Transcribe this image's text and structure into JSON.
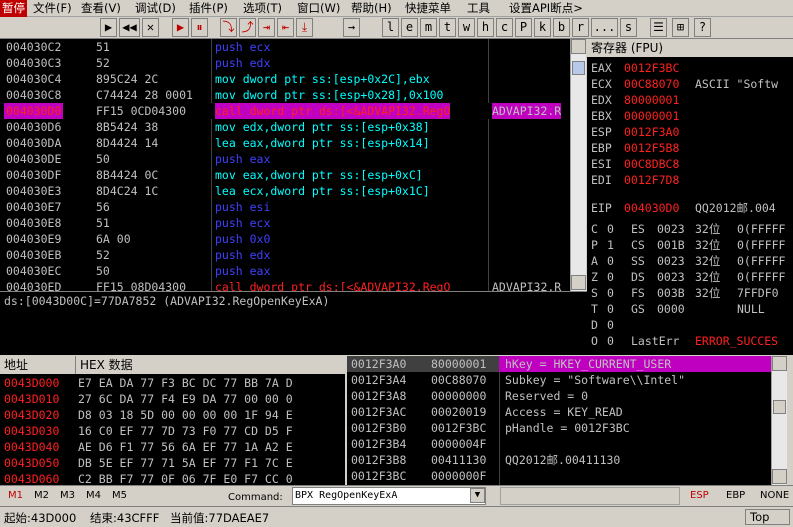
{
  "menubar": {
    "status": "暂停",
    "items": [
      "文件(F)",
      "查看(V)",
      "调试(D)",
      "插件(P)",
      "选项(T)",
      "窗口(W)",
      "帮助(H)",
      "快捷菜单",
      "工具",
      "设置API断点>"
    ]
  },
  "toolbar": {
    "buttons": [
      "▶",
      "◀◀",
      "✕",
      "▶",
      "⏸",
      "⤵",
      "⤴",
      "⇥",
      "⇤",
      "⤓",
      "→",
      "l",
      "e",
      "m",
      "t",
      "w",
      "h",
      "c",
      "P",
      "k",
      "b",
      "r",
      "...",
      "s",
      "☰",
      "⊞",
      "?"
    ]
  },
  "disasm": [
    {
      "addr": "004030C2",
      "hex": "51",
      "asm": "push ecx",
      "acls": "blue"
    },
    {
      "addr": "004030C3",
      "hex": "52",
      "asm": "push edx",
      "acls": "blue"
    },
    {
      "addr": "004030C4",
      "hex": "895C24 2C",
      "asm": "mov dword ptr ss:[esp+0x2C],ebx",
      "acls": "cyan"
    },
    {
      "addr": "004030C8",
      "hex": "C74424 28 0001",
      "asm": "mov dword ptr ss:[esp+0x28],0x100",
      "acls": "cyan"
    },
    {
      "addr": "004030D0",
      "hex": "FF15 0CD04300",
      "asm": "call dword ptr ds:[<&ADVAPI32.RegO",
      "acls": "red",
      "comment": "ADVAPI32.R",
      "hl": true
    },
    {
      "addr": "004030D6",
      "hex": "8B5424 38",
      "asm": "mov edx,dword ptr ss:[esp+0x38]",
      "acls": "cyan"
    },
    {
      "addr": "004030DA",
      "hex": "8D4424 14",
      "asm": "lea eax,dword ptr ss:[esp+0x14]",
      "acls": "cyan"
    },
    {
      "addr": "004030DE",
      "hex": "50",
      "asm": "push eax",
      "acls": "blue"
    },
    {
      "addr": "004030DF",
      "hex": "8B4424 0C",
      "asm": "mov eax,dword ptr ss:[esp+0xC]",
      "acls": "cyan"
    },
    {
      "addr": "004030E3",
      "hex": "8D4C24 1C",
      "asm": "lea ecx,dword ptr ss:[esp+0x1C]",
      "acls": "cyan"
    },
    {
      "addr": "004030E7",
      "hex": "56",
      "asm": "push esi",
      "acls": "blue"
    },
    {
      "addr": "004030E8",
      "hex": "51",
      "asm": "push ecx",
      "acls": "blue"
    },
    {
      "addr": "004030E9",
      "hex": "6A 00",
      "asm": "push 0x0",
      "acls": "blue"
    },
    {
      "addr": "004030EB",
      "hex": "52",
      "asm": "push edx",
      "acls": "blue"
    },
    {
      "addr": "004030EC",
      "hex": "50",
      "asm": "push eax",
      "acls": "blue"
    },
    {
      "addr": "004030ED",
      "hex": "FF15 08D04300",
      "asm": "call dword ptr ds:[<&ADVAPI32.RegO",
      "acls": "red",
      "comment": "ADVAPI32.R"
    }
  ],
  "info_line": "ds:[0043D00C]=77DA7852 (ADVAPI32.RegOpenKeyExA)",
  "registers": {
    "title": "寄存器 (FPU)",
    "regs": [
      {
        "n": "EAX",
        "v": "0012F3BC",
        "note": ""
      },
      {
        "n": "ECX",
        "v": "00C88070",
        "note": "ASCII \"Softw"
      },
      {
        "n": "EDX",
        "v": "80000001",
        "note": ""
      },
      {
        "n": "EBX",
        "v": "00000001",
        "note": ""
      },
      {
        "n": "ESP",
        "v": "0012F3A0",
        "note": ""
      },
      {
        "n": "EBP",
        "v": "0012F5B8",
        "note": ""
      },
      {
        "n": "ESI",
        "v": "00C8DBC8",
        "note": ""
      },
      {
        "n": "EDI",
        "v": "0012F7D8",
        "note": ""
      }
    ],
    "eip": {
      "n": "EIP",
      "v": "004030D0",
      "note": "QQ2012邮.004"
    },
    "flags": [
      {
        "f": "C",
        "b": "0",
        "seg": "ES",
        "sv": "0023",
        "bits": "32位",
        "rest": "0(FFFFF"
      },
      {
        "f": "P",
        "b": "1",
        "seg": "CS",
        "sv": "001B",
        "bits": "32位",
        "rest": "0(FFFFF"
      },
      {
        "f": "A",
        "b": "0",
        "seg": "SS",
        "sv": "0023",
        "bits": "32位",
        "rest": "0(FFFFF"
      },
      {
        "f": "Z",
        "b": "0",
        "seg": "DS",
        "sv": "0023",
        "bits": "32位",
        "rest": "0(FFFFF"
      },
      {
        "f": "S",
        "b": "0",
        "seg": "FS",
        "sv": "003B",
        "bits": "32位",
        "rest": "7FFDF0"
      },
      {
        "f": "T",
        "b": "0",
        "seg": "GS",
        "sv": "0000",
        "bits": "",
        "rest": "NULL"
      },
      {
        "f": "D",
        "b": "0",
        "seg": "",
        "sv": "",
        "bits": "",
        "rest": ""
      },
      {
        "f": "O",
        "b": "0",
        "seg": "",
        "sv": "",
        "bits": "",
        "rest": "LastErr",
        "err": "ERROR_SUCCES"
      }
    ]
  },
  "dump": {
    "hdr_addr": "地址",
    "hdr_hex": "HEX 数据",
    "rows": [
      {
        "a": "0043D000",
        "h": "E7 EA DA 77 F3 BC DC 77 BB 7A D"
      },
      {
        "a": "0043D010",
        "h": "27 6C DA 77 F4 E9 DA 77 00 00 0"
      },
      {
        "a": "0043D020",
        "h": "D8 03 18 5D 00 00 00 00 1F 94 E"
      },
      {
        "a": "0043D030",
        "h": "16 C0 EF 77 7D 73 F0 77 CD D5 F"
      },
      {
        "a": "0043D040",
        "h": "AE D6 F1 77 56 6A EF 77 1A A2 E"
      },
      {
        "a": "0043D050",
        "h": "DB 5E EF 77 71 5A EF 77 F1 7C E"
      },
      {
        "a": "0043D060",
        "h": "C2 BB F7 77 0F 06 7F E0 F7 CC 0"
      }
    ]
  },
  "stack": {
    "rows": [
      {
        "a": "0012F3A0",
        "v": "80000001",
        "c": "hKey = HKEY_CURRENT_USER",
        "hl": true
      },
      {
        "a": "0012F3A4",
        "v": "00C88070",
        "c": "Subkey = \"Software\\\\Intel\""
      },
      {
        "a": "0012F3A8",
        "v": "00000000",
        "c": "Reserved = 0"
      },
      {
        "a": "0012F3AC",
        "v": "00020019",
        "c": "Access = KEY_READ"
      },
      {
        "a": "0012F3B0",
        "v": "0012F3BC",
        "c": "pHandle = 0012F3BC"
      },
      {
        "a": "0012F3B4",
        "v": "0000004F",
        "c": ""
      },
      {
        "a": "0012F3B8",
        "v": "00411130",
        "c": "QQ2012邮.00411130"
      },
      {
        "a": "0012F3BC",
        "v": "0000000F",
        "c": ""
      }
    ]
  },
  "bottom": {
    "tabs": [
      "M1",
      "M2",
      "M3",
      "M4",
      "M5"
    ],
    "command_label": "Command:",
    "command_value": "BPX RegOpenKeyExA",
    "esp": "ESP",
    "ebp": "EBP",
    "none": "NONE"
  },
  "status": {
    "start": "起始:43D000",
    "end": "结束:43CFFF",
    "current": "当前值:77DAEAE7",
    "top": "Top"
  }
}
